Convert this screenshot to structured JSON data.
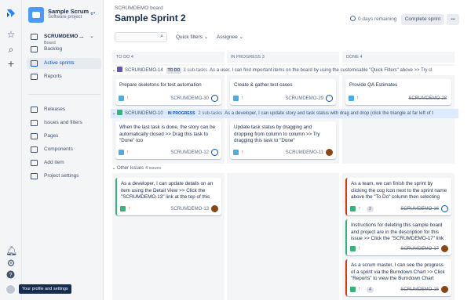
{
  "project": {
    "name": "Sample Scrum ...",
    "type": "Software project"
  },
  "sidebar": {
    "board_name": "SCRUMDEMO ...",
    "board_label": "Board",
    "items": [
      {
        "label": "Backlog"
      },
      {
        "label": "Active sprints"
      },
      {
        "label": "Reports"
      },
      {
        "label": "Releases"
      },
      {
        "label": "Issues and filters"
      },
      {
        "label": "Pages"
      },
      {
        "label": "Components"
      },
      {
        "label": "Add item"
      },
      {
        "label": "Project settings"
      }
    ],
    "tooltip": "Your profile and settings"
  },
  "header": {
    "breadcrumb": "SCRUMDEMO board",
    "title": "Sample Sprint 2",
    "days_remaining": "0 days remaining",
    "complete_button": "Complete sprint",
    "more_button": "•••"
  },
  "toolbar": {
    "quick_filters": "Quick filters ⌄",
    "assignee": "Assignee ⌄"
  },
  "columns": [
    "TO DO 4",
    "IN PROGRESS 3",
    "DONE 4"
  ],
  "swimlanes": [
    {
      "key": "SCRUMDEMO-14",
      "status": "TO DO",
      "subtasks": "3 sub-tasks",
      "summary": "As a user, I can find important items on the board by using the customisable \"Quick Filters\" above >> Try cl"
    },
    {
      "key": "SCRUMDEMO-10",
      "status": "IN PROGRESS",
      "subtasks": "2 sub-tasks",
      "summary": "As a developer, I can update story and task status with drag and drop (click the triangle at far left of t"
    },
    {
      "key": "Other Issues",
      "status": "",
      "subtasks": "4 issues",
      "summary": ""
    }
  ],
  "cards": {
    "r1_todo": {
      "text": "Prepare skeletons for test automation",
      "key": "SCRUMDEMO-30"
    },
    "r1_prog": {
      "text": "Create & gather test cases",
      "key": "SCRUMDEMO-29"
    },
    "r1_done": {
      "text": "Provide QA Estimates",
      "key": "SCRUMDEMO-28"
    },
    "r2_todo": {
      "text": "When the last task is done, the story can be automatically closed >> Drag this task to \"Done\" too",
      "key": "SCRUMDEMO-12"
    },
    "r2_prog": {
      "text": "Update task status by dragging and dropping from column to column >> Try dragging this task to \"Done\"",
      "key": "SCRUMDEMO-11"
    },
    "r3_todo": {
      "text": "As a developer, I can update details on an item using the Detail View >> Click the \"SCRUMDEMO-13\" link at the top of this",
      "key": "SCRUMDEMO-13"
    },
    "r3_done1": {
      "text": "As a team, we can finish the sprint by clicking the cog icon next to the sprint name above the \"To Do\" column then selecting",
      "key": "SCRUMDEMO-16",
      "estimate": "2"
    },
    "r3_done2": {
      "text": "Instructions for deleting this sample board and project are in the description for this issue >> Click the \"SCRUMDEMO-17\" link",
      "key": "SCRUMDEMO-17"
    },
    "r3_done3": {
      "text": "As a scrum master, I can see the progress of a sprint via the Burndown Chart >> Click \"Reports\" to view the Burndown Chart",
      "key": "SCRUMDEMO-15",
      "estimate": "4"
    }
  },
  "colors": {
    "accent": "#0052cc",
    "story": "#36b37e",
    "task": "#4bade8",
    "priority": "#ff5630",
    "flag_red": "#de350b"
  }
}
